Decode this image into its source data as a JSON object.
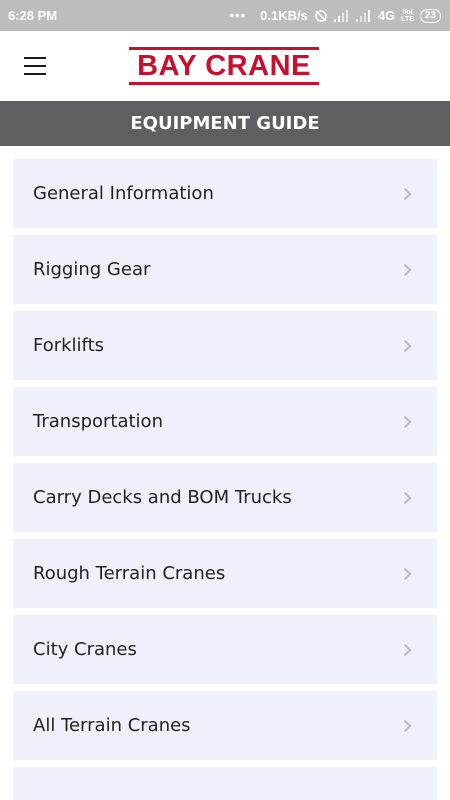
{
  "status_bar": {
    "time": "6:28 PM",
    "dots": "•••",
    "net_speed": "0.1KB/s",
    "network": "4G",
    "volte_line1": "Voi",
    "volte_line2": "LTE",
    "battery": "23",
    "icons": [
      "mute-alarm-icon",
      "signal-icon",
      "signal-icon",
      "battery-icon"
    ]
  },
  "header": {
    "menu_icon": "hamburger-menu-icon",
    "logo_text": "BAY CRANE",
    "brand_color": "#c8102e"
  },
  "titlebar": {
    "title": "EQUIPMENT GUIDE",
    "background": "#5e5f62"
  },
  "list": {
    "item_background": "#eef1f9",
    "chevron_icon": "chevron-right-icon",
    "items": [
      {
        "label": "General Information"
      },
      {
        "label": "Rigging Gear"
      },
      {
        "label": "Forklifts"
      },
      {
        "label": "Transportation"
      },
      {
        "label": "Carry Decks and BOM Trucks"
      },
      {
        "label": "Rough Terrain Cranes"
      },
      {
        "label": "City Cranes"
      },
      {
        "label": "All Terrain Cranes"
      },
      {
        "label": ""
      }
    ]
  }
}
